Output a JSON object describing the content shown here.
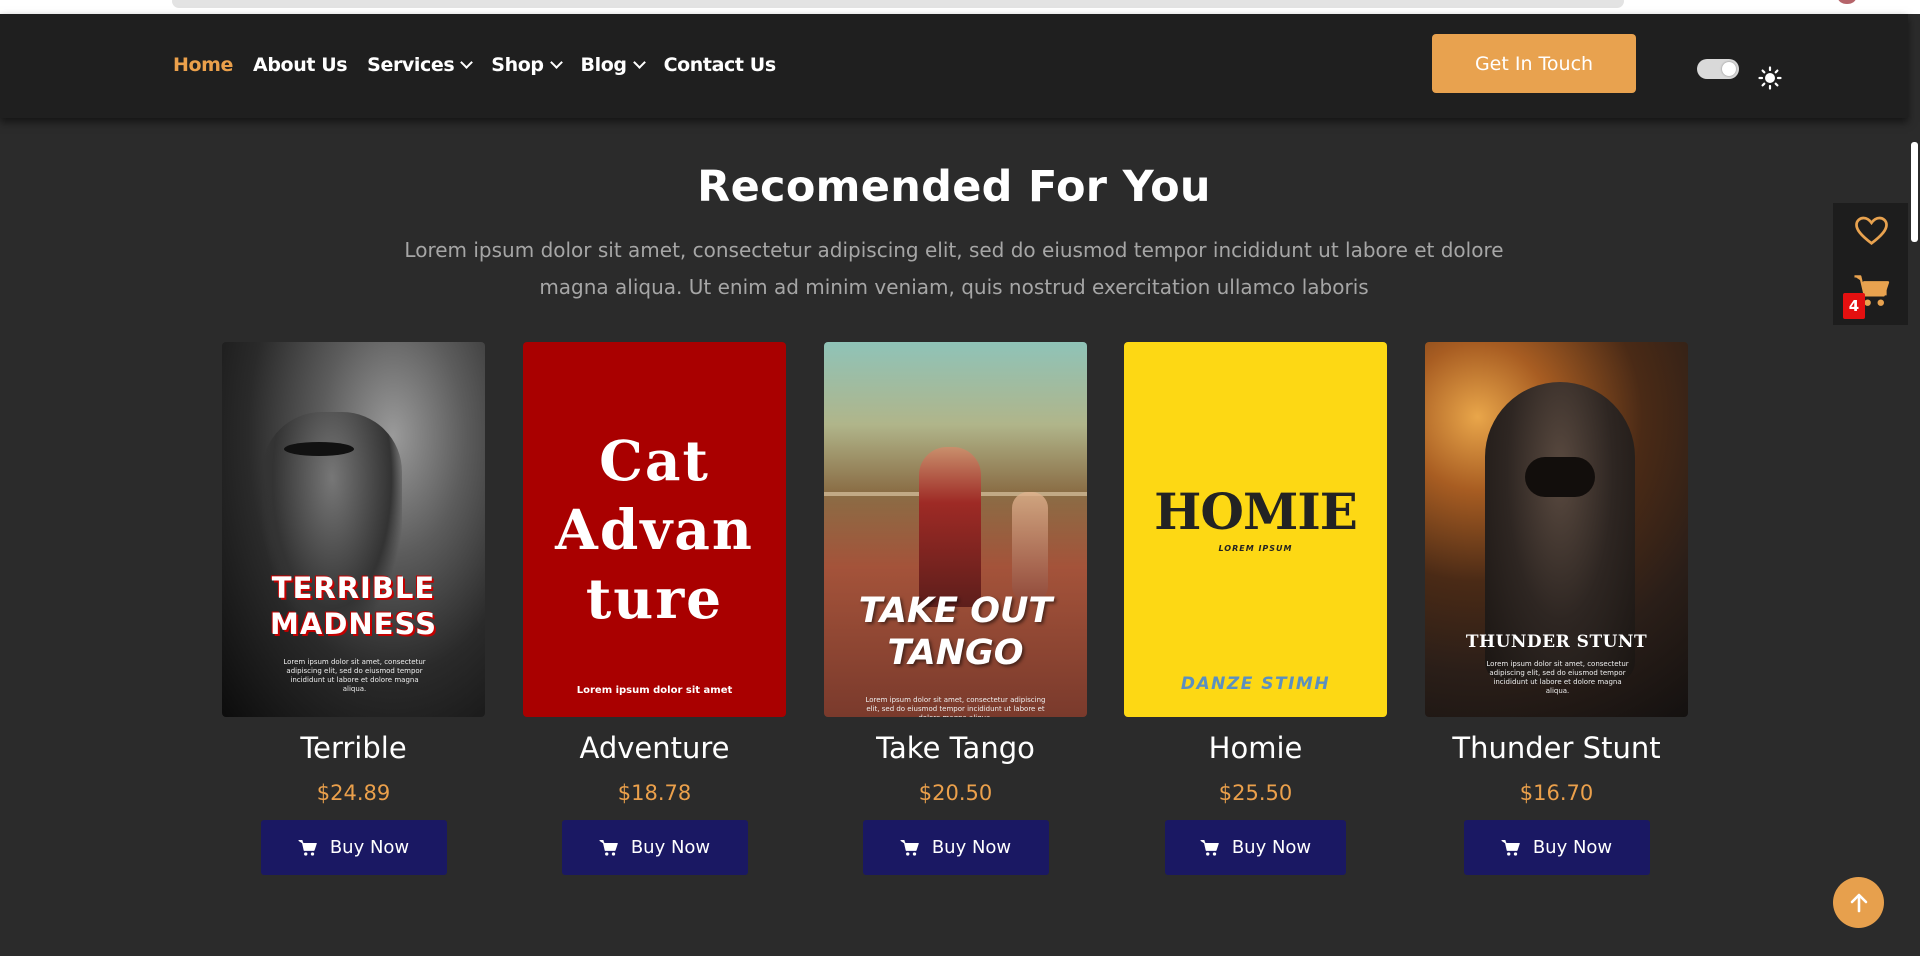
{
  "nav": {
    "items": [
      {
        "label": "Home",
        "active": true,
        "dropdown": false
      },
      {
        "label": "About Us",
        "active": false,
        "dropdown": false
      },
      {
        "label": "Services",
        "active": false,
        "dropdown": true
      },
      {
        "label": "Shop",
        "active": false,
        "dropdown": true
      },
      {
        "label": "Blog",
        "active": false,
        "dropdown": true
      },
      {
        "label": "Contact Us",
        "active": false,
        "dropdown": false
      }
    ],
    "cta_label": "Get In Touch",
    "theme_toggle_on": true
  },
  "side_panel": {
    "cart_count": "4"
  },
  "section": {
    "title": "Recomended For You",
    "description": "Lorem ipsum dolor sit amet, consectetur adipiscing elit, sed do eiusmod tempor incididunt ut labore et dolore magna aliqua. Ut enim ad minim veniam, quis nostrud exercitation ullamco laboris"
  },
  "products": [
    {
      "title": "Terrible",
      "price": "$24.89",
      "buy_label": "Buy Now",
      "cover": {
        "line1": "TERRIBLE",
        "line2": "MADNESS",
        "fine": "Lorem ipsum dolor sit amet, consectetur adipiscing elit, sed do eiusmod tempor incididunt ut labore et dolore magna aliqua."
      }
    },
    {
      "title": "Adventure",
      "price": "$18.78",
      "buy_label": "Buy Now",
      "cover": {
        "line1": "Cat",
        "line2": "Advan",
        "line3": "ture",
        "fine": "Lorem ipsum dolor sit amet"
      }
    },
    {
      "title": "Take Tango",
      "price": "$20.50",
      "buy_label": "Buy Now",
      "cover": {
        "line1": "TAKE OUT",
        "line2": "TANGO",
        "fine": "Lorem ipsum dolor sit amet, consectetur adipiscing elit, sed do eiusmod tempor incididunt ut labore et dolore magna aliqua."
      }
    },
    {
      "title": "Homie",
      "price": "$25.50",
      "buy_label": "Buy Now",
      "cover": {
        "line1": "HOMIE",
        "line2": "LOREM IPSUM",
        "line3": "DANZE STIMH"
      }
    },
    {
      "title": "Thunder Stunt",
      "price": "$16.70",
      "buy_label": "Buy Now",
      "cover": {
        "line1": "THUNDER STUNT",
        "fine": "Lorem ipsum dolor sit amet, consectetur adipiscing elit, sed do eiusmod tempor incididunt ut labore et dolore magna aliqua."
      }
    }
  ],
  "colors": {
    "accent": "#e8a24f",
    "nav_bg": "#1f1f1f",
    "page_bg": "#2b2b2b",
    "buy_button": "#1a1863",
    "badge": "#e41010",
    "homie_cover": "#fdd814",
    "adventure_cover": "#a90000"
  },
  "icons": [
    "chevron-down-icon",
    "sun-icon",
    "heart-icon",
    "cart-icon",
    "arrow-up-icon"
  ]
}
